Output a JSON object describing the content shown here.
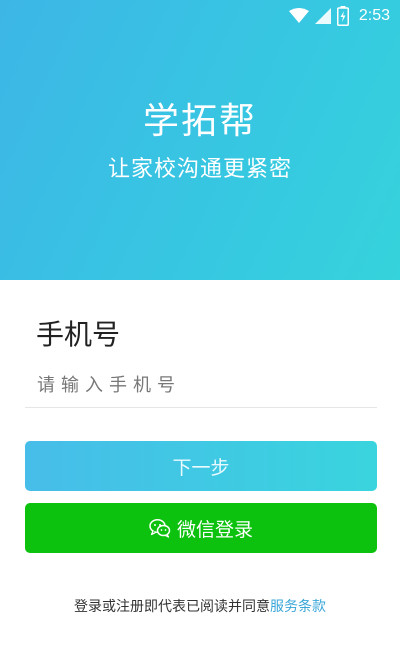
{
  "status_bar": {
    "time": "2:53"
  },
  "hero": {
    "app_name": "学拓帮",
    "slogan": "让家校沟通更紧密"
  },
  "login_form": {
    "phone_label": "手机号",
    "phone_placeholder": "请输入手机号",
    "next_button": "下一步",
    "wechat_button": "微信登录"
  },
  "agreement": {
    "prefix": "登录或注册即代表已阅读并同意",
    "link": "服务条款"
  },
  "colors": {
    "accent": "#3db6e6",
    "wechat": "#0dc20e",
    "link": "#3aa6d8"
  }
}
